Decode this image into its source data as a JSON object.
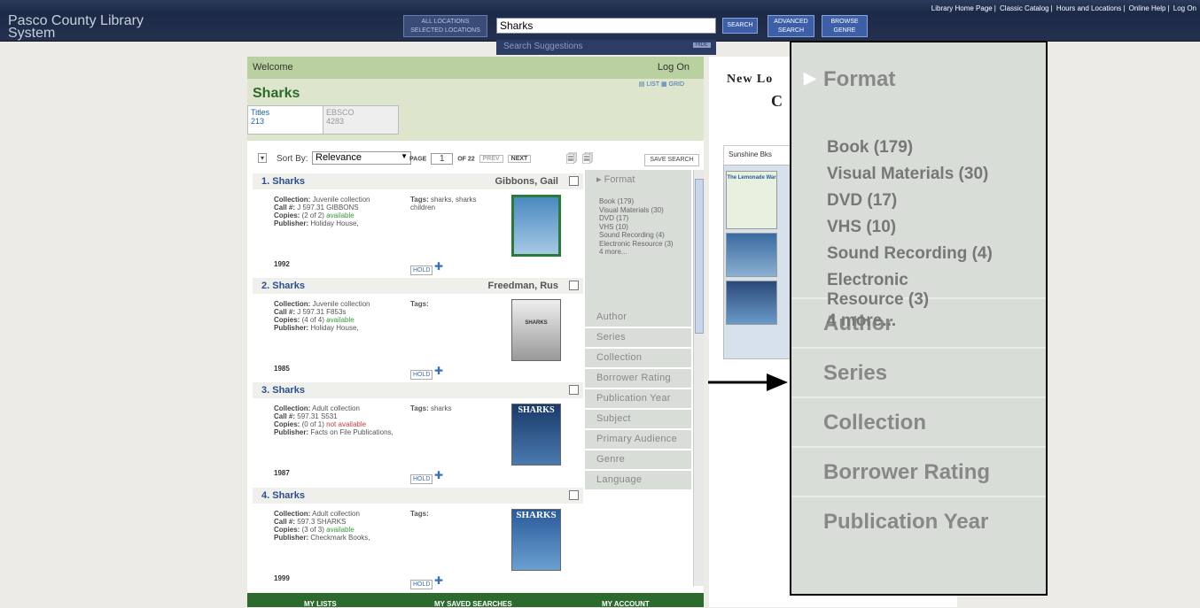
{
  "header": {
    "links": [
      "Library Home Page",
      "Classic Catalog",
      "Hours and Locations",
      "Online Help",
      "Log On"
    ],
    "brand_line1": "Pasco County Library",
    "brand_line2": "System",
    "loc_all": "ALL LOCATIONS",
    "loc_selected": "SELECTED LOCATIONS",
    "search_value": "Sharks",
    "search_btn": "SEARCH",
    "adv_line1": "ADVANCED",
    "adv_line2": "SEARCH",
    "genre_line1": "BROWSE",
    "genre_line2": "GENRE",
    "suggestions": "Search Suggestions",
    "hide": "HIDE"
  },
  "main": {
    "welcome": "Welcome",
    "logon": "Log On",
    "query": "Sharks",
    "list": "LIST",
    "grid": "GRID",
    "tab_titles": "Titles",
    "tab_titles_count": "213",
    "tab_ebsco": "EBSCO",
    "tab_ebsco_count": "4283",
    "sort_label": "Sort By:",
    "sort_value": "Relevance",
    "page_label": "PAGE",
    "page_num": "1",
    "of_label": "OF 22",
    "prev": "PREV",
    "next": "NEXT",
    "save": "SAVE SEARCH"
  },
  "records": [
    {
      "num": "1.",
      "title": "Sharks",
      "author": "Gibbons, Gail",
      "collection": "Juvenile collection",
      "call": "J 597.31 GIBBONS",
      "copies": "(2 of 2)",
      "status": "available",
      "publisher": "Holiday House,",
      "tags": "sharks, sharks children",
      "year": "1992",
      "hold": "HOLD"
    },
    {
      "num": "2.",
      "title": "Sharks",
      "author": "Freedman, Rus",
      "collection": "Juvenile collection",
      "call": "J 597.31 F853s",
      "copies": "(4 of 4)",
      "status": "available",
      "publisher": "Holiday House,",
      "tags": "",
      "year": "1985",
      "hold": "HOLD"
    },
    {
      "num": "3.",
      "title": "Sharks",
      "author": "",
      "collection": "Adult collection",
      "call": "597.31 S531",
      "copies": "(0 of 1)",
      "status": "not available",
      "publisher": "Facts on File Publications,",
      "tags": "sharks",
      "year": "1987",
      "hold": "HOLD"
    },
    {
      "num": "4.",
      "title": "Sharks",
      "author": "",
      "collection": "Adult collection",
      "call": "597.3 SHARKS",
      "copies": "(3 of 3)",
      "status": "available",
      "publisher": "Checkmark Books,",
      "tags": "",
      "year": "1999",
      "hold": "HOLD"
    }
  ],
  "labels": {
    "collection": "Collection:",
    "call": "Call #:",
    "copies": "Copies:",
    "publisher": "Publisher:",
    "tags": "Tags:"
  },
  "facets": {
    "format": "Format",
    "format_items": [
      "Book (179)",
      "Visual Materials (30)",
      "DVD (17)",
      "VHS (10)",
      "Sound Recording (4)",
      "Electronic Resource (3)",
      "4 more..."
    ],
    "others": [
      "Author",
      "Series",
      "Collection",
      "Borrower Rating",
      "Publication Year",
      "Subject",
      "Primary Audience",
      "Genre",
      "Language"
    ]
  },
  "covers": {
    "c2": "SHARKS",
    "c3": "SHARKS",
    "c4": "SHARKS"
  },
  "bottom": {
    "lists": "MY LISTS",
    "saved": "MY SAVED SEARCHES",
    "account": "MY ACCOUNT"
  },
  "right": {
    "hdr": "New Lo",
    "hdr2": "C",
    "tab": "Sunshine Bks",
    "book1": "The Lemonade War"
  },
  "zoom": {
    "format": "Format",
    "items": [
      "Book (179)",
      "Visual Materials (30)",
      "DVD (17)",
      "VHS (10)",
      "Sound Recording (4)",
      "Electronic",
      "Resource (3)",
      "4 more..."
    ],
    "sections": [
      "Author",
      "Series",
      "Collection",
      "Borrower Rating",
      "Publication Year"
    ]
  }
}
